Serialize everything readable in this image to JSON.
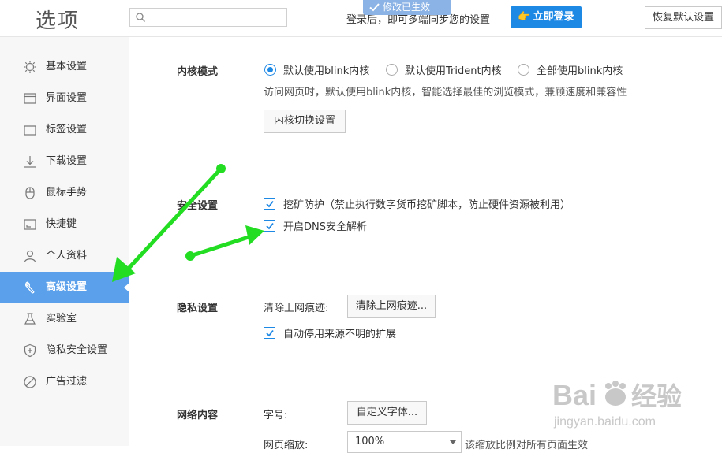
{
  "header": {
    "title": "选项",
    "search_placeholder": "",
    "toast": "修改已生效",
    "login_hint": "登录后，即可多端同步您的设置",
    "login_button": "立即登录",
    "restore_button": "恢复默认设置"
  },
  "sidebar": {
    "items": [
      {
        "label": "基本设置",
        "icon": "gear-icon"
      },
      {
        "label": "界面设置",
        "icon": "window-icon"
      },
      {
        "label": "标签设置",
        "icon": "tab-icon"
      },
      {
        "label": "下载设置",
        "icon": "download-icon"
      },
      {
        "label": "鼠标手势",
        "icon": "mouse-icon"
      },
      {
        "label": "快捷键",
        "icon": "keyboard-icon"
      },
      {
        "label": "个人资料",
        "icon": "user-icon"
      },
      {
        "label": "高级设置",
        "icon": "wrench-icon",
        "active": true
      },
      {
        "label": "实验室",
        "icon": "flask-icon"
      },
      {
        "label": "隐私安全设置",
        "icon": "shield-icon"
      },
      {
        "label": "广告过滤",
        "icon": "block-icon"
      }
    ]
  },
  "kernel": {
    "label": "内核模式",
    "options": [
      "默认使用blink内核",
      "默认使用Trident内核",
      "全部使用blink内核"
    ],
    "selected_index": 0,
    "desc": "访问网页时，默认使用blink内核，智能选择最佳的浏览模式，兼顾速度和兼容性",
    "switch_button": "内核切换设置"
  },
  "security": {
    "label": "安全设置",
    "mining_label": "挖矿防护（禁止执行数字货币挖矿脚本，防止硬件资源被利用）",
    "mining_checked": true,
    "dns_label": "开启DNS安全解析",
    "dns_checked": true
  },
  "privacy": {
    "label": "隐私设置",
    "clear_label": "清除上网痕迹:",
    "clear_button": "清除上网痕迹...",
    "auto_disable_label": "自动停用来源不明的扩展",
    "auto_disable_checked": true
  },
  "web_content": {
    "label": "网络内容",
    "font_label": "字号:",
    "font_button": "自定义字体...",
    "zoom_label": "网页缩放:",
    "zoom_value": "100%",
    "zoom_note": "该缩放比例对所有页面生效"
  },
  "watermark": {
    "brand": "Bai",
    "brand2": "经验",
    "url": "jingyan.baidu.com"
  },
  "colors": {
    "accent": "#1e88e5",
    "sidebar_active": "#5aa0eb",
    "arrow": "#22dd22"
  }
}
